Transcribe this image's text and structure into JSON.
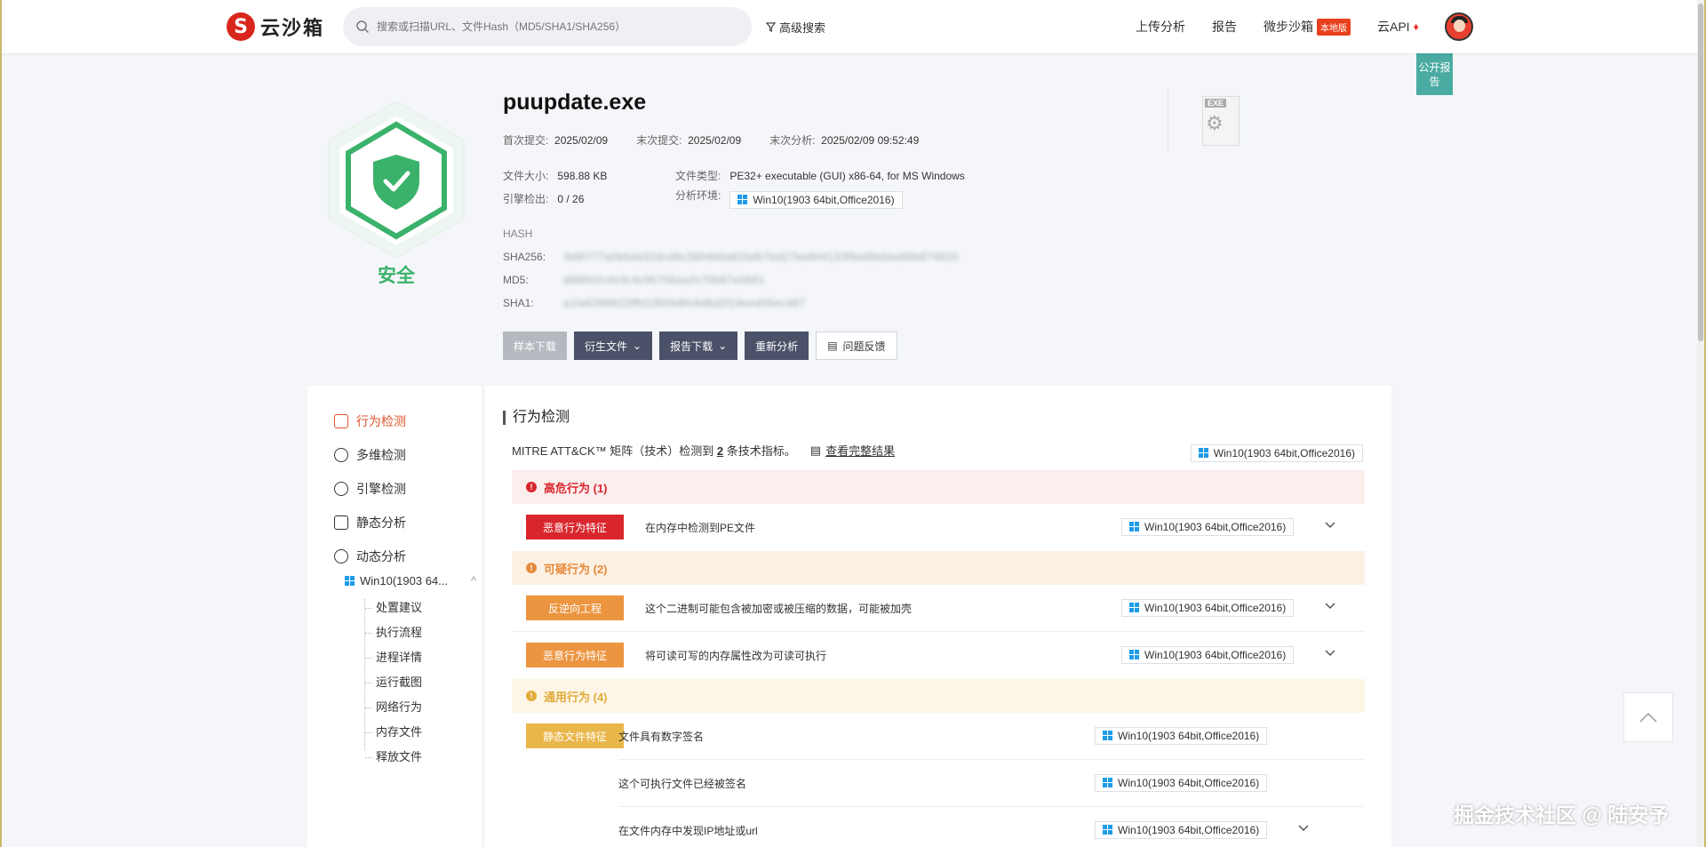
{
  "header": {
    "logo_glyph": "S",
    "logo_text": "云沙箱",
    "search_placeholder": "搜索或扫描URL、文件Hash（MD5/SHA1/SHA256）",
    "advanced_search": "高级搜索",
    "nav": {
      "upload": "上传分析",
      "report": "报告",
      "sandbox": "微步沙箱",
      "sandbox_badge": "本地版",
      "api": "云API"
    }
  },
  "public_report": "公开报告",
  "verdict": "安全",
  "file": {
    "name": "puupdate.exe",
    "first_submit_label": "首次提交:",
    "first_submit": "2025/02/09",
    "last_submit_label": "末次提交:",
    "last_submit": "2025/02/09",
    "last_analysis_label": "末次分析:",
    "last_analysis": "2025/02/09 09:52:49",
    "size_label": "文件大小:",
    "size": "598.88 KB",
    "type_label": "文件类型:",
    "type": "PE32+ executable (GUI) x86-64, for MS Windows",
    "engines_label": "引擎检出:",
    "engines": "0 / 26",
    "env_label": "分析环境:",
    "env": "Win10(1903 64bit,Office2016)",
    "exe_icon_label": "EXE",
    "hash_title": "HASH",
    "sha256_label": "SHA256:",
    "sha256": "3d8f777a0b5da32dcd9c3804b0a82fafb7bd27ba804133f9ed5b0ea69b874820",
    "md5_label": "MD5:",
    "md5": "d88602c4e3c4c95756aa2c70b87e0661",
    "sha1_label": "SHA1:",
    "sha1": "a1fa6399922fffd1900b8fc6d6d2f19eed05ec467"
  },
  "actions": {
    "sample_download": "样本下载",
    "derived_files": "衍生文件",
    "report_download": "报告下载",
    "reanalyze": "重新分析",
    "feedback": "问题反馈"
  },
  "sidebar": {
    "items": [
      {
        "label": "行为检测"
      },
      {
        "label": "多维检测"
      },
      {
        "label": "引擎检测"
      },
      {
        "label": "静态分析"
      },
      {
        "label": "动态分析"
      }
    ],
    "env_short": "Win10(1903 64...",
    "tree": [
      "处置建议",
      "执行流程",
      "进程详情",
      "运行截图",
      "网络行为",
      "内存文件",
      "释放文件"
    ]
  },
  "main": {
    "title": "行为检测",
    "mitre_prefix": "MITRE ATT&CK™ 矩阵（技术）检测到",
    "mitre_count": "2",
    "mitre_suffix": "条技术指标。",
    "full_result": "查看完整结果",
    "env": "Win10(1903 64bit,Office2016)",
    "groups": {
      "high": "高危行为 (1)",
      "suspicious": "可疑行为 (2)",
      "general": "通用行为 (4)"
    },
    "rows": [
      {
        "tag": "恶意行为特征",
        "desc": "在内存中检测到PE文件",
        "env": "Win10(1903 64bit,Office2016)"
      },
      {
        "tag": "反逆向工程",
        "desc": "这个二进制可能包含被加密或被压缩的数据，可能被加壳",
        "env": "Win10(1903 64bit,Office2016)"
      },
      {
        "tag": "恶意行为特征",
        "desc": "将可读可写的内存属性改为可读可执行",
        "env": "Win10(1903 64bit,Office2016)"
      },
      {
        "tag": "静态文件特征",
        "desc": "文件具有数字签名",
        "env": "Win10(1903 64bit,Office2016)"
      },
      {
        "tag": "",
        "desc": "这个可执行文件已经被签名",
        "env": "Win10(1903 64bit,Office2016)"
      },
      {
        "tag": "",
        "desc": "在文件内存中发现IP地址或url",
        "env": "Win10(1903 64bit,Office2016)"
      }
    ]
  },
  "watermark": "掘金技术社区 @ 陆安予",
  "colors": {
    "safe_green": "#3bb26b",
    "accent_orange": "#e0542b",
    "high_red": "#d9262c",
    "suspicious_orange": "#ec9540",
    "general_yellow": "#e9b64a",
    "dark_button": "#4a5168",
    "public_teal": "#4aaba2"
  }
}
